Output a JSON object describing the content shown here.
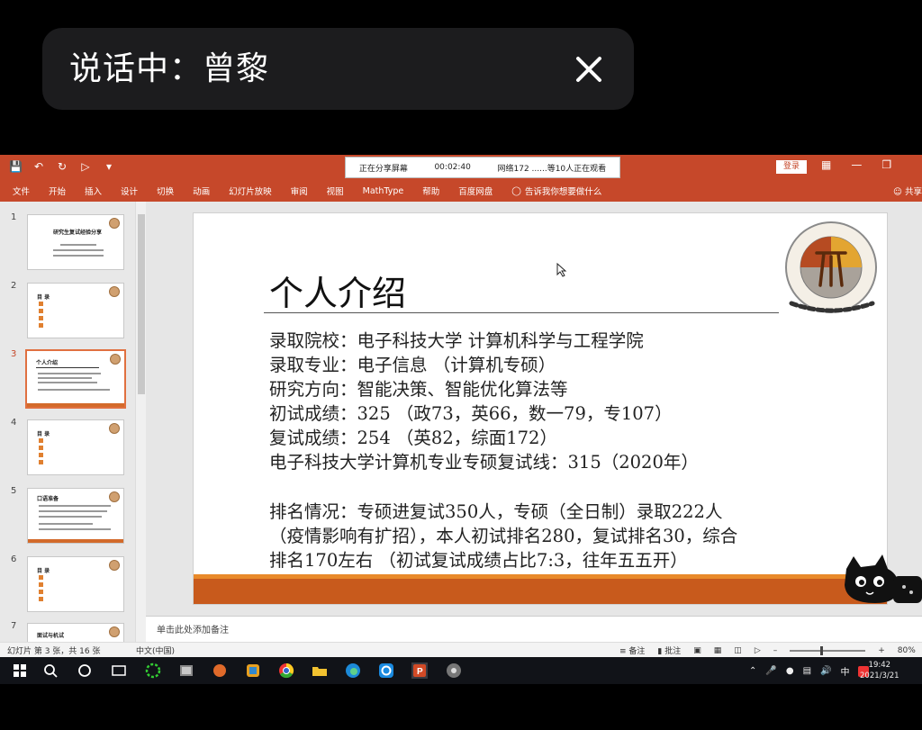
{
  "call": {
    "speaking_label": "说话中：曾黎"
  },
  "titlebar": {
    "banner_sharing": "正在分享屏幕",
    "banner_time": "00:02:40",
    "banner_viewers": "网络172 ......等10人正在观看",
    "login_label": "登录"
  },
  "ribbon": {
    "tabs": [
      "文件",
      "开始",
      "插入",
      "设计",
      "切换",
      "动画",
      "幻灯片放映",
      "审阅",
      "视图",
      "MathType",
      "帮助",
      "百度网盘"
    ],
    "tell_me": "告诉我你想要做什么",
    "share_label": "共享"
  },
  "thumbnails": [
    {
      "num": "1",
      "title": "研究生复试经验分享"
    },
    {
      "num": "2",
      "title": "目 录"
    },
    {
      "num": "3",
      "title": "个人介绍"
    },
    {
      "num": "4",
      "title": "目 录"
    },
    {
      "num": "5",
      "title": "口语准备"
    },
    {
      "num": "6",
      "title": "目 录"
    },
    {
      "num": "7",
      "title": "面试与机试"
    }
  ],
  "slide": {
    "title": "个人介绍",
    "lines": [
      "录取院校：电子科技大学 计算机科学与工程学院",
      "录取专业：电子信息 （计算机专硕）",
      "研究方向：智能决策、智能优化算法等",
      "初试成绩：325 （政73，英66，数一79，专107）",
      "复试成绩：254 （英82，综面172）",
      "电子科技大学计算机专业专硕复试线：315（2020年）"
    ],
    "paragraph2": [
      "排名情况：专硕进复试350人，专硕（全日制）录取222人",
      "（疫情影响有扩招），本人初试排名280，复试排名30，综合",
      "排名170左右 （初试复试成绩占比7:3，往年五五开）"
    ]
  },
  "notes": {
    "placeholder": "单击此处添加备注"
  },
  "statusbar": {
    "slide_info": "幻灯片 第 3 张，共 16 张",
    "language": "中文(中国)",
    "notes_btn": "备注",
    "comments_btn": "批注",
    "zoom": "80%",
    "zoom_fraction": 0.4
  },
  "taskbar": {
    "ime": "中",
    "time": "19:42",
    "date": "2021/3/21"
  }
}
